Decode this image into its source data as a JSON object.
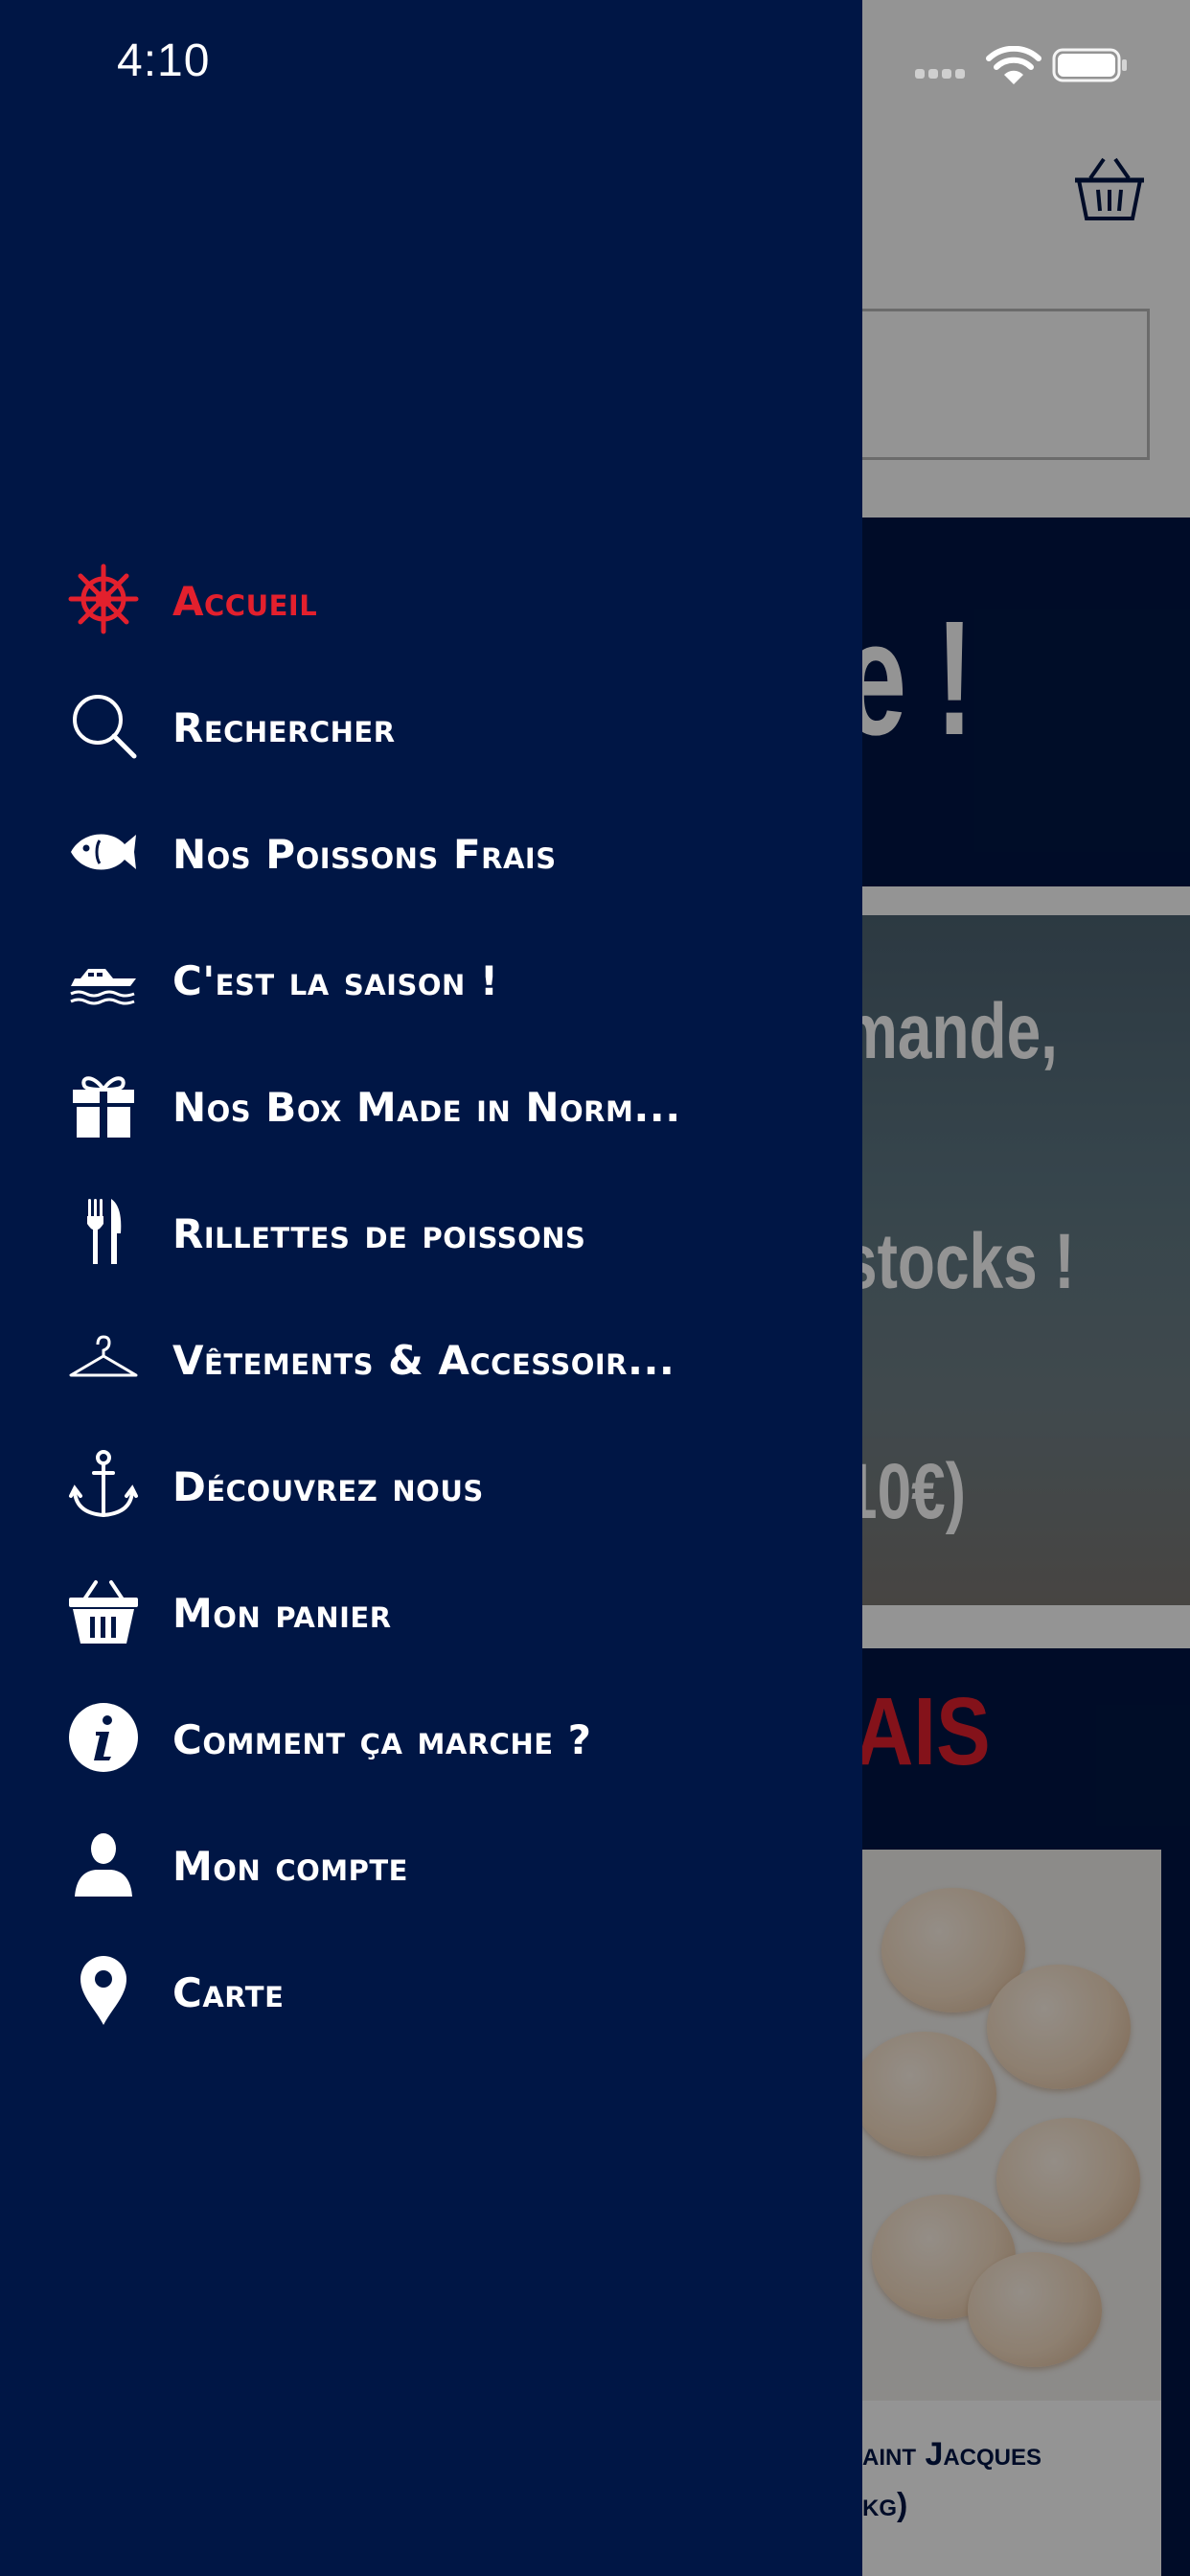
{
  "status_bar": {
    "time": "4:10"
  },
  "menu": {
    "items": [
      {
        "label": "Accueil",
        "icon": "ship-wheel-icon",
        "active": true
      },
      {
        "label": "Rechercher",
        "icon": "search-icon",
        "active": false
      },
      {
        "label": "Nos Poissons Frais",
        "icon": "fish-icon",
        "active": false
      },
      {
        "label": "C'est la saison !",
        "icon": "boat-icon",
        "active": false
      },
      {
        "label": "Nos Box Made in Norm...",
        "icon": "gift-icon",
        "active": false
      },
      {
        "label": "Rillettes de poissons",
        "icon": "fork-knife-icon",
        "active": false
      },
      {
        "label": "Vêtements & Accessoir...",
        "icon": "hanger-icon",
        "active": false
      },
      {
        "label": "Découvrez nous",
        "icon": "anchor-icon",
        "active": false
      },
      {
        "label": "Mon panier",
        "icon": "basket-icon",
        "active": false
      },
      {
        "label": "Comment ça marche ?",
        "icon": "info-icon",
        "active": false
      },
      {
        "label": "Mon compte",
        "icon": "user-icon",
        "active": false
      },
      {
        "label": "Carte",
        "icon": "map-pin-icon",
        "active": false
      }
    ]
  },
  "background": {
    "hero_fragment": "e !",
    "photo_lines": [
      "mande,",
      "stocks !",
      "10€)"
    ],
    "section_title_fragment": "AIS",
    "product_title_fragment": "aint Jacques",
    "product_sub_fragment": "kg)"
  },
  "colors": {
    "navy": "#001645",
    "accent_red": "#e3202d",
    "white": "#ffffff"
  }
}
